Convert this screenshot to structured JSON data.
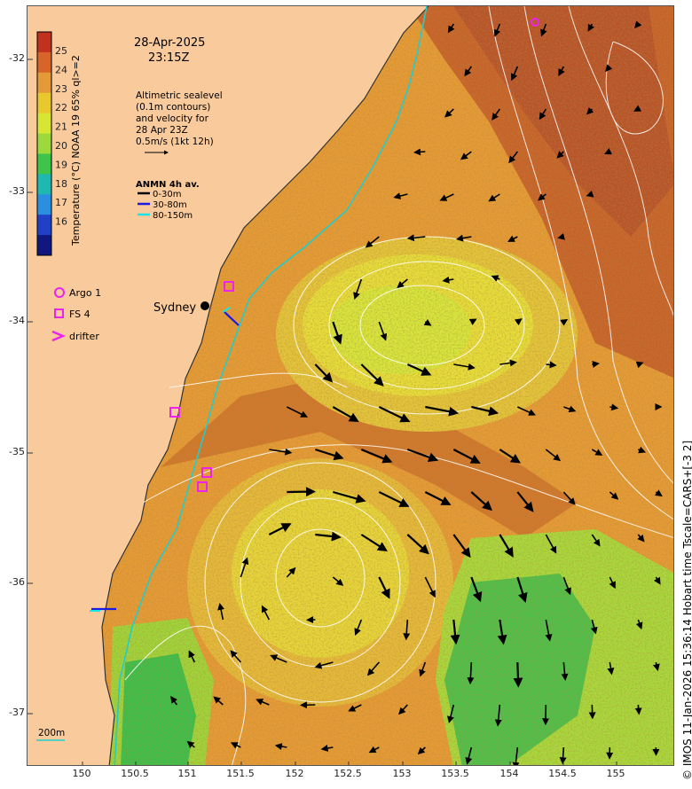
{
  "title": {
    "date": "28-Apr-2025",
    "time": "23:15Z"
  },
  "colorbar": {
    "label": "Temperature (°C) NOAA 19 65% ql>=2",
    "ticks": [
      "25",
      "24",
      "23",
      "22",
      "21",
      "20",
      "19",
      "18",
      "17",
      "16"
    ],
    "colors": [
      "#c0321e",
      "#d7652a",
      "#e49a39",
      "#e9c82d",
      "#d7e632",
      "#9bd93c",
      "#3ec44a",
      "#1fb8b0",
      "#2a8fe0",
      "#2040c8",
      "#101880"
    ]
  },
  "altimetry_note": {
    "lines": [
      "Altimetric sealevel",
      "(0.1m contours)",
      "and velocity for",
      "28 Apr 23Z",
      "0.5m/s (1kt 12h)"
    ]
  },
  "anmn": {
    "title": "ANMN 4h av.",
    "items": [
      {
        "label": "0-30m",
        "color": "#000000"
      },
      {
        "label": "30-80m",
        "color": "#1a1ae6"
      },
      {
        "label": "80-150m",
        "color": "#18e6e6"
      }
    ]
  },
  "legend": {
    "items": [
      {
        "label": "Argo 1",
        "symbol": "circle"
      },
      {
        "label": "FS 4",
        "symbol": "square"
      },
      {
        "label": "drifter",
        "symbol": "chevron"
      }
    ]
  },
  "city": {
    "label": "Sydney"
  },
  "depth_label": "200m",
  "axes": {
    "x_ticks": [
      "150",
      "150.5",
      "151",
      "151.5",
      "152",
      "152.5",
      "153",
      "153.5",
      "154",
      "154.5",
      "155"
    ],
    "y_ticks": [
      "-32",
      "-33",
      "-34",
      "-35",
      "-36",
      "-37"
    ]
  },
  "credit": "© IMOS 11-Jan-2026 15:36:14 Hobart time Tscale=CARS+[-3 2]",
  "colors": {
    "land": "#f9ca9c",
    "magenta": "#ee22ee",
    "shelf_break": "#22cccc"
  }
}
